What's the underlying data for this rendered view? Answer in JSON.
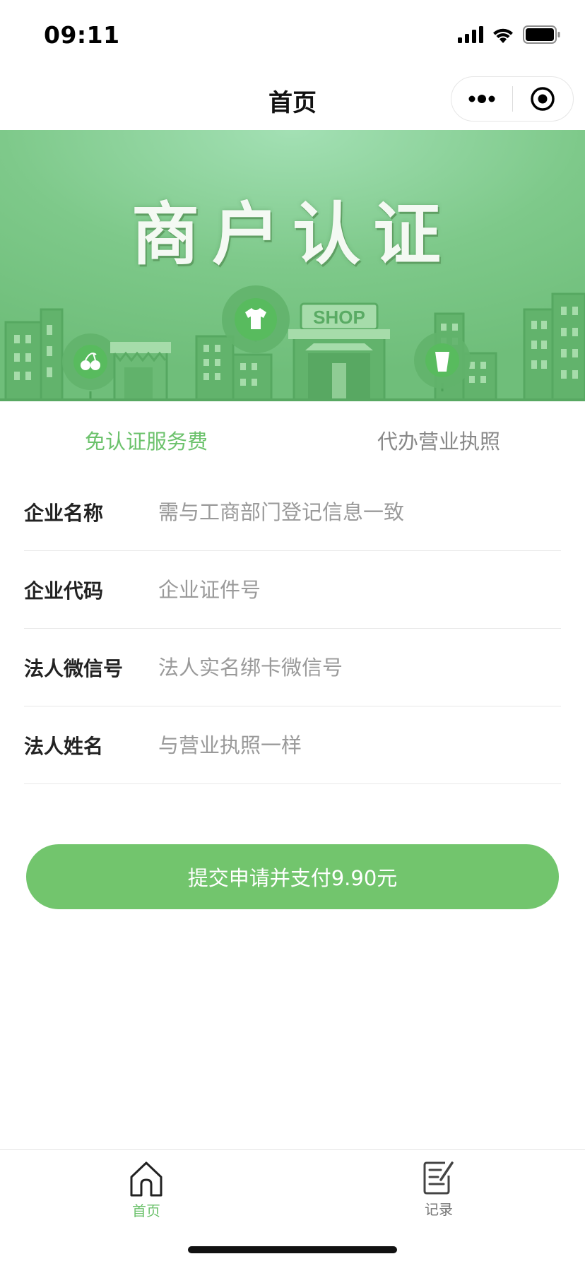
{
  "status_bar": {
    "time": "09:11",
    "icons": [
      "signal-icon",
      "wifi-icon",
      "battery-icon"
    ]
  },
  "nav": {
    "title": "首页",
    "capsule": [
      "more-icon",
      "close-mini-program-icon"
    ]
  },
  "banner": {
    "title": "商户认证",
    "shop_sign": "SHOP"
  },
  "tabs": [
    {
      "label": "免认证服务费",
      "active": true
    },
    {
      "label": "代办营业执照",
      "active": false
    }
  ],
  "form": {
    "fields": [
      {
        "label": "企业名称",
        "placeholder": "需与工商部门登记信息一致",
        "value": ""
      },
      {
        "label": "企业代码",
        "placeholder": "企业证件号",
        "value": ""
      },
      {
        "label": "法人微信号",
        "placeholder": "法人实名绑卡微信号",
        "value": ""
      },
      {
        "label": "法人姓名",
        "placeholder": "与营业执照一样",
        "value": ""
      }
    ]
  },
  "submit": {
    "label": "提交申请并支付9.90元"
  },
  "tab_bar": {
    "items": [
      {
        "label": "首页",
        "icon": "home-icon",
        "active": true
      },
      {
        "label": "记录",
        "icon": "record-icon",
        "active": false
      }
    ]
  },
  "colors": {
    "accent": "#72c56d",
    "active_tab": "#6cc26c",
    "banner_green": "#7cc587"
  }
}
